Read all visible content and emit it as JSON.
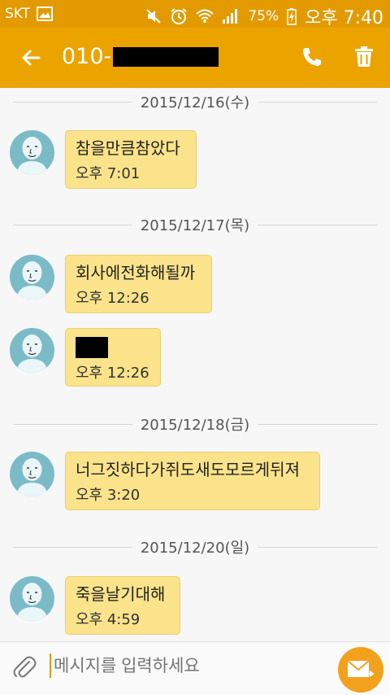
{
  "status_bar": {
    "carrier": "SKT",
    "battery_percent": "75%",
    "time": "오후 7:40",
    "icons": [
      "gallery-icon",
      "mute-icon",
      "alarm-icon",
      "wifi-icon",
      "signal-icon",
      "battery-charging-icon"
    ]
  },
  "app_bar": {
    "title_prefix": "010-",
    "icons": [
      "back-arrow-icon",
      "phone-icon",
      "trash-icon"
    ]
  },
  "conversation": [
    {
      "date": "2015/12/16(수)",
      "messages": [
        {
          "text": "참을만큼참았다",
          "time": "오후 7:01"
        }
      ]
    },
    {
      "date": "2015/12/17(목)",
      "messages": [
        {
          "text": "회사에전화해될까",
          "time": "오후 12:26"
        },
        {
          "text": "",
          "time": "오후 12:26",
          "redacted": true
        }
      ]
    },
    {
      "date": "2015/12/18(금)",
      "messages": [
        {
          "text": "너그짓하다가쥐도새도모르게뒤져",
          "time": "오후 3:20"
        }
      ]
    },
    {
      "date": "2015/12/20(일)",
      "messages": [
        {
          "text": "죽을날기대해",
          "time": "오후 4:59"
        }
      ]
    }
  ],
  "composer": {
    "placeholder": "메시지를 입력하세요",
    "icons": [
      "paperclip-icon",
      "send-mail-icon"
    ]
  },
  "colors": {
    "status_bar": "#e39a00",
    "app_bar": "#eba300",
    "bubble": "#fae38a",
    "avatar": "#7bbbc8",
    "send_button": "#f2a11d"
  }
}
